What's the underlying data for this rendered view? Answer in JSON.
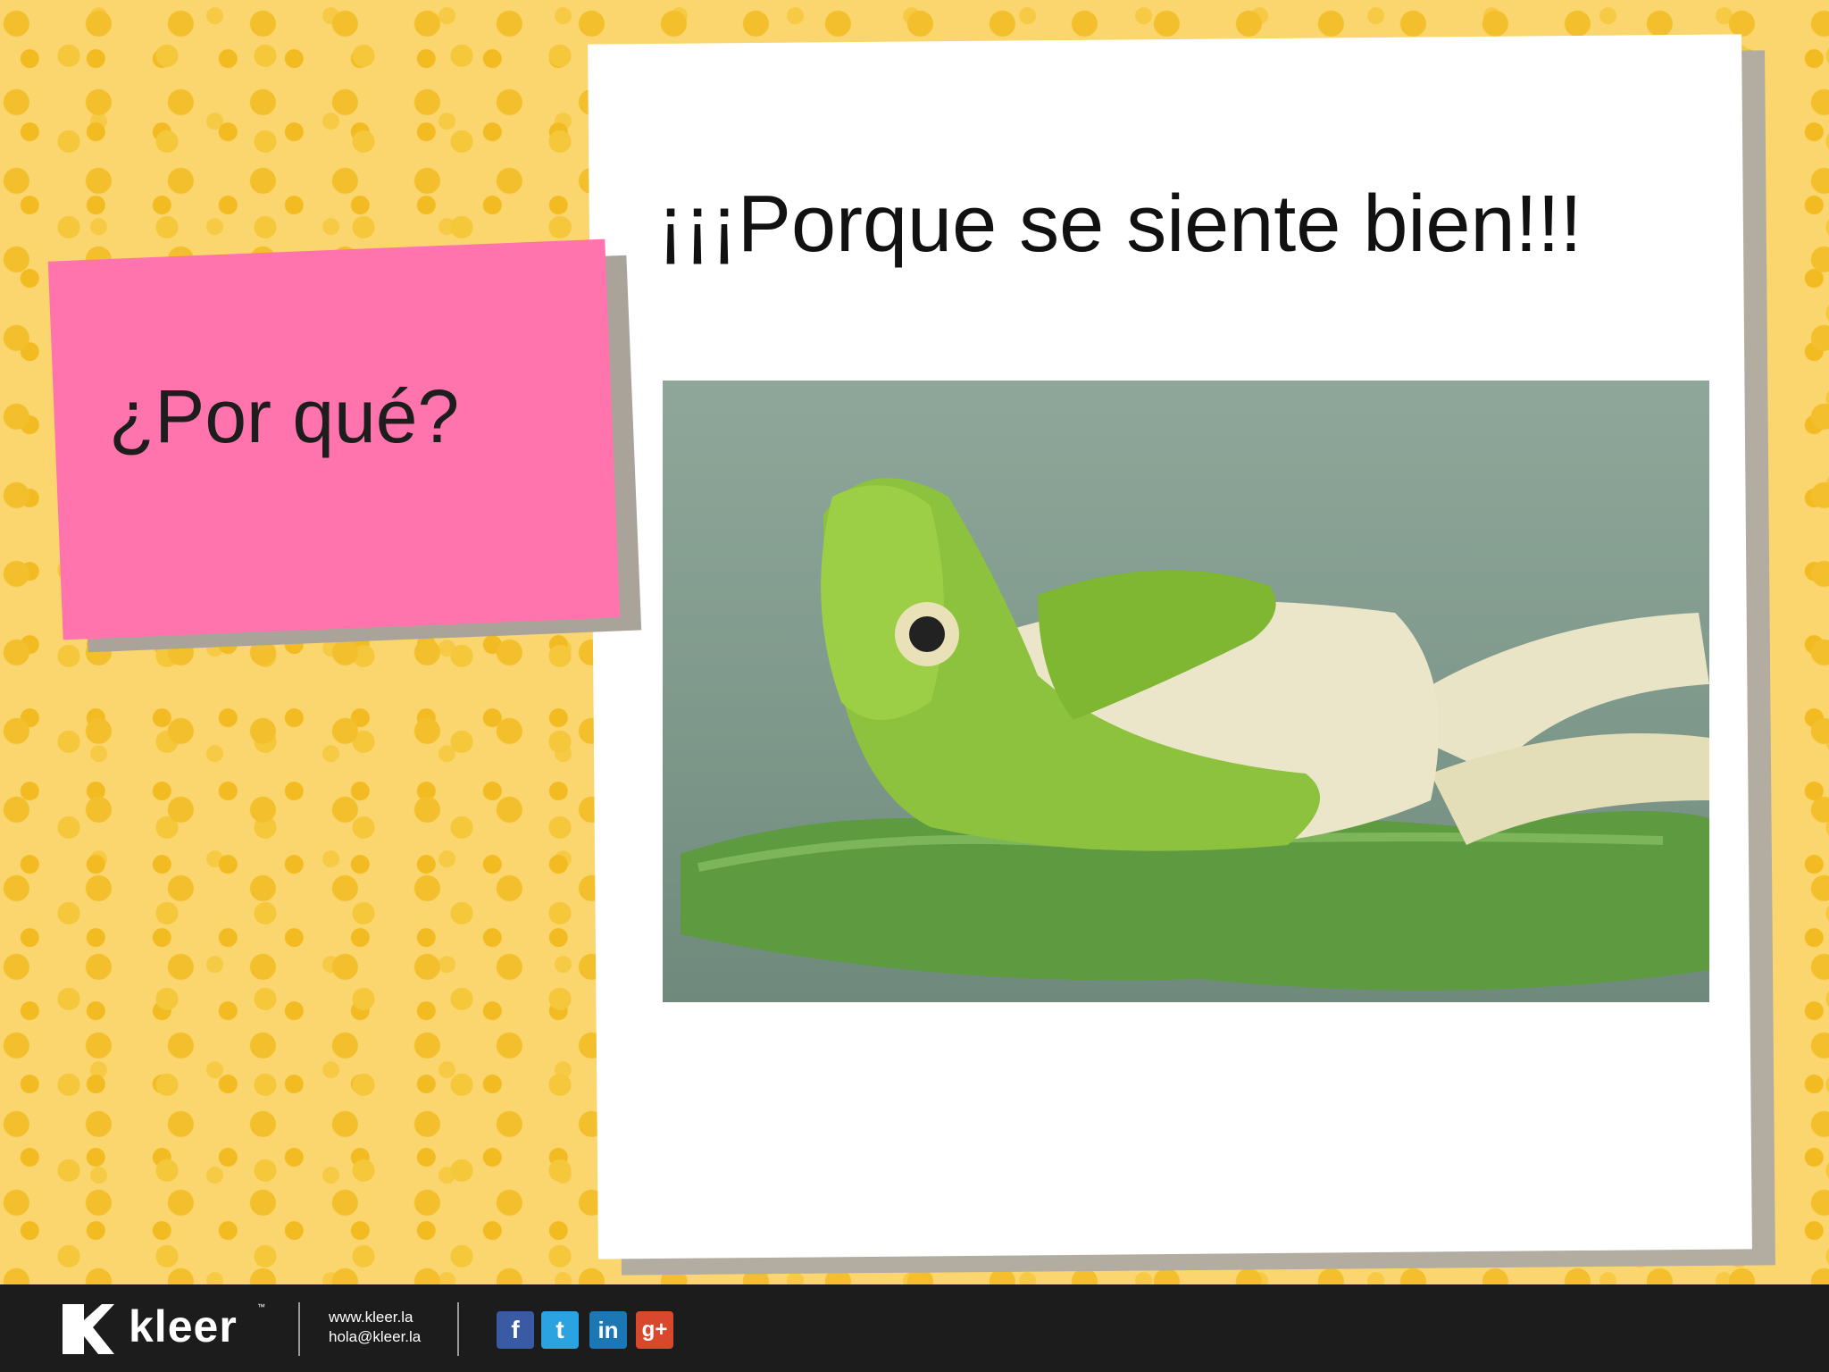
{
  "slide": {
    "question": "¿Por qué?",
    "answer": "¡¡¡Porque se siente bien!!!",
    "image": {
      "icon": "relaxing-frog-photo"
    }
  },
  "footer": {
    "brand": "kleer",
    "trademark": "™",
    "website": "www.kleer.la",
    "email": "hola@kleer.la",
    "social": [
      {
        "icon": "facebook-icon",
        "label": "f"
      },
      {
        "icon": "twitter-icon",
        "label": "t"
      },
      {
        "icon": "linkedin-icon",
        "label": "in"
      },
      {
        "icon": "google-plus-icon",
        "label": "g+"
      }
    ]
  },
  "colors": {
    "background": "#fbd66e",
    "note": "#ff74ac",
    "footer": "#1c1c1c"
  }
}
